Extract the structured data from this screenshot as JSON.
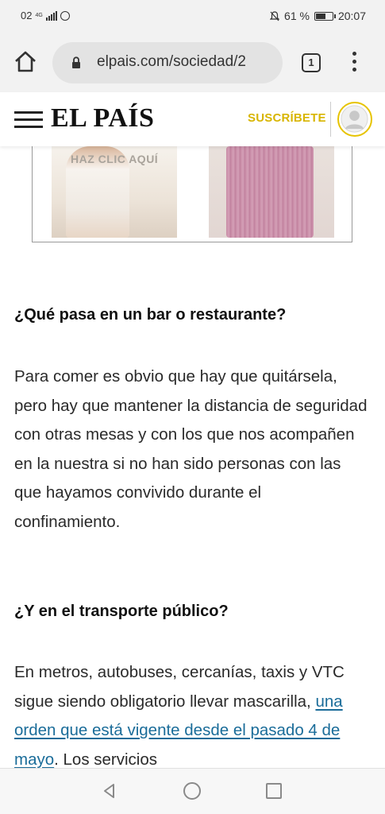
{
  "status_bar": {
    "carrier": "02",
    "network": "4G",
    "battery": "61 %",
    "battery_level": 0.61,
    "time": "20:07",
    "icons": [
      "signal-icon",
      "whatsapp-icon",
      "bell-off-icon",
      "battery-icon"
    ]
  },
  "browser": {
    "url": "elpais.com/sociedad/2",
    "tab_count": "1",
    "icons": [
      "home-icon",
      "lock-icon",
      "tabs-icon",
      "overflow-menu-icon"
    ]
  },
  "site_header": {
    "logo": "EL PAÍS",
    "subscribe_label": "SUSCRÍBETE",
    "accent_color": "#d8b500",
    "icons": [
      "hamburger-menu-icon",
      "user-avatar-icon"
    ]
  },
  "ad": {
    "caption": "HAZ CLIC AQUÍ"
  },
  "article": {
    "heading1": "¿Qué pasa en un bar o restaurante?",
    "para1": "Para comer es obvio que hay que quitársela, pero hay que mantener la distancia de seguridad con otras mesas y con los que nos acompañen en la nuestra si no han sido personas con las que hayamos convivido durante el confinamiento.",
    "heading2": "¿Y en el transporte público?",
    "para2_before": "En metros, autobuses, cercanías, taxis y VTC sigue siendo obligatorio llevar mascarilla, ",
    "para2_link": "una orden que está vigente desde el pasado 4 de mayo",
    "para2_after": ". Los servicios",
    "link_color": "#1a6c99"
  },
  "nav_bar": {
    "icons": [
      "back-icon",
      "home-circle-icon",
      "recent-apps-icon"
    ]
  }
}
